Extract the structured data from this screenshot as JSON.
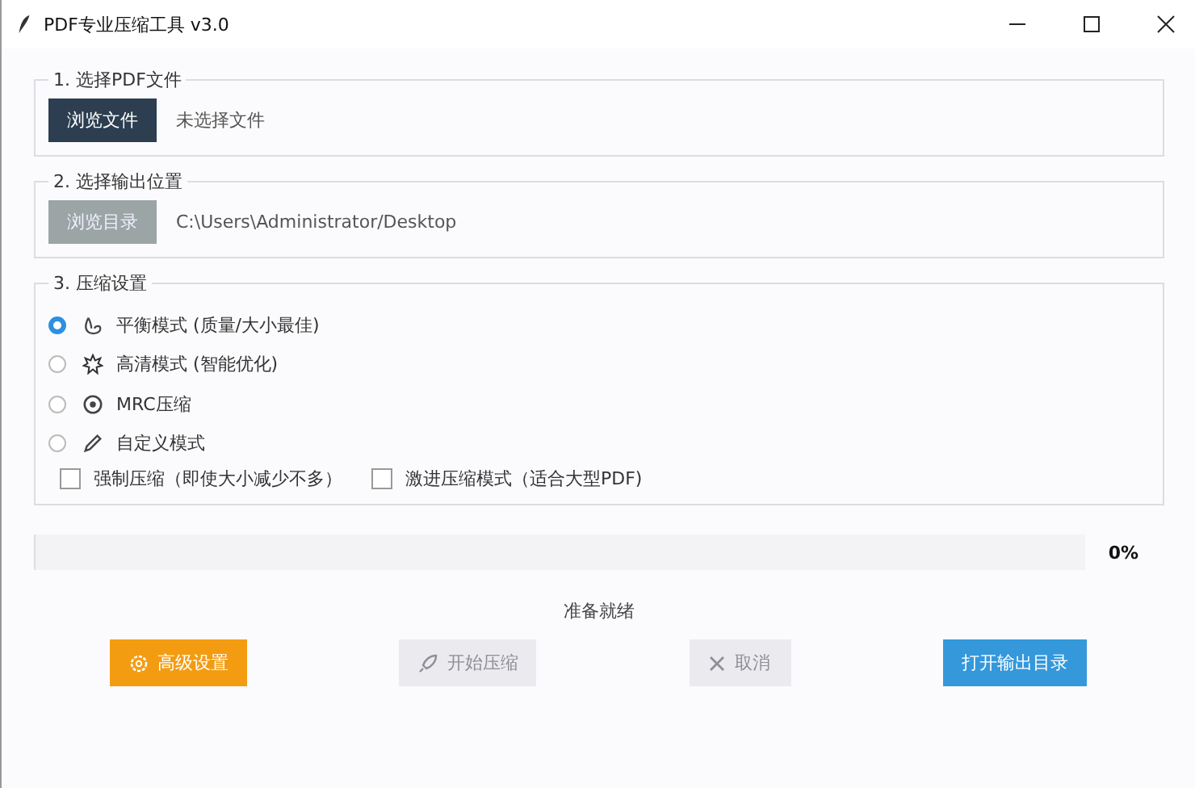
{
  "window": {
    "title": "PDF专业压缩工具 v3.0"
  },
  "file_section": {
    "title": "1. 选择PDF文件",
    "button": {
      "label": "浏览文件",
      "disabled": false
    },
    "path": "未选择文件"
  },
  "output_section": {
    "title": "2. 选择输出位置",
    "button": {
      "label": "浏览目录",
      "disabled": true
    },
    "path": "C:\\Users\\Administrator/Desktop"
  },
  "compression_section": {
    "title": "3. 压缩设置",
    "modes": [
      {
        "kind": "balance",
        "label": "平衡模式 (质量/大小最佳)",
        "selected": true
      },
      {
        "kind": "hd",
        "label": "高清模式 (智能优化)",
        "selected": false
      },
      {
        "kind": "mrc",
        "label": "MRC压缩",
        "selected": false
      },
      {
        "kind": "custom",
        "label": "自定义模式",
        "selected": false
      }
    ],
    "options": [
      {
        "label": "强制压缩（即使大小减少不多）",
        "checked": false
      },
      {
        "label": "激进压缩模式（适合大型PDF)",
        "checked": false
      }
    ]
  },
  "progress": {
    "level": 0,
    "reading": "0%"
  },
  "status": "准备就绪",
  "buttons": [
    {
      "kind": "settings",
      "label": "高级设置",
      "disabled": false
    },
    {
      "kind": "start",
      "label": "开始压缩",
      "disabled": true
    },
    {
      "kind": "cancel",
      "label": "取消",
      "disabled": true
    },
    {
      "kind": "open",
      "label": "打开输出目录",
      "disabled": false
    }
  ]
}
